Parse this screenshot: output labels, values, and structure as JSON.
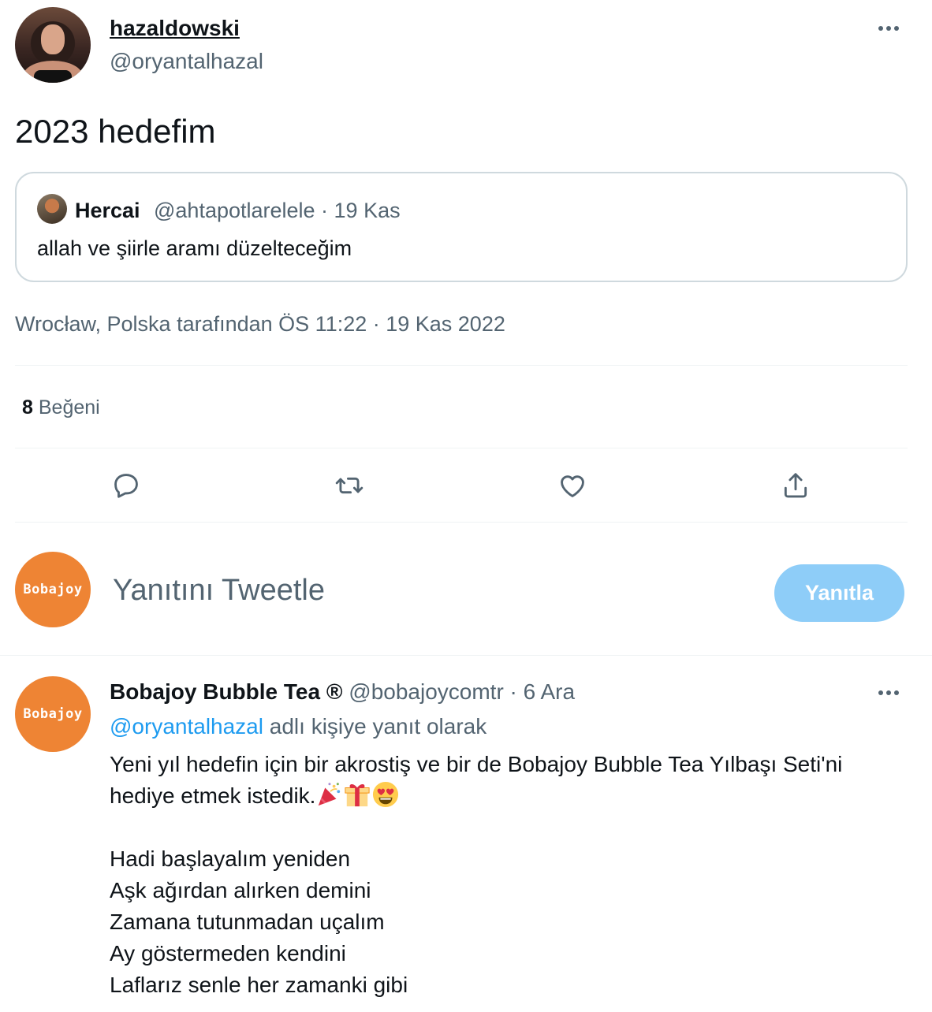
{
  "tweet": {
    "author_name": "hazaldowski",
    "author_handle": "@oryantalhazal",
    "text": "2023 hedefim",
    "quote": {
      "name": "Hercai",
      "meta": "@ahtapotlarelele · 19 Kas",
      "text": "allah ve şiirle aramı düzelteceğim"
    },
    "timestamp": "Wrocław, Polska tarafından ÖS 11:22 · 19 Kas 2022",
    "likes_count": "8",
    "likes_label": "Beğeni",
    "actions": {
      "reply_icon": "reply-icon",
      "retweet_icon": "retweet-icon",
      "like_icon": "heart-icon",
      "share_icon": "share-icon"
    }
  },
  "compose": {
    "avatar_text": "Bobajoy",
    "placeholder": "Yanıtını Tweetle",
    "button_label": "Yanıtla",
    "button_color": "#8ecdf8"
  },
  "reply": {
    "avatar_text": "Bobajoy",
    "name": "Bobajoy Bubble Tea ®",
    "meta": " @bobajoycomtr · 6 Ara",
    "reply_to_mention": "@oryantalhazal",
    "reply_to_suffix": " adlı kişiye yanıt olarak",
    "line1": "Yeni yıl hedefin için bir akrostiş ve bir de Bobajoy Bubble Tea Yılbaşı Seti'ni",
    "line2": "hediye etmek istedik.",
    "emojis": [
      "party-popper",
      "wrapped-gift",
      "heart-eyes"
    ],
    "poem": [
      "Hadi başlayalım yeniden",
      "Aşk ağırdan alırken demini",
      "Zamana tutunmadan uçalım",
      "Ay göstermeden kendini",
      "Laflarız senle her zamanki gibi"
    ]
  },
  "colors": {
    "text_primary": "#0f1419",
    "text_secondary": "#536471",
    "link": "#1d9bf0",
    "brand_orange": "#ee8434",
    "border": "#cfd9de"
  }
}
